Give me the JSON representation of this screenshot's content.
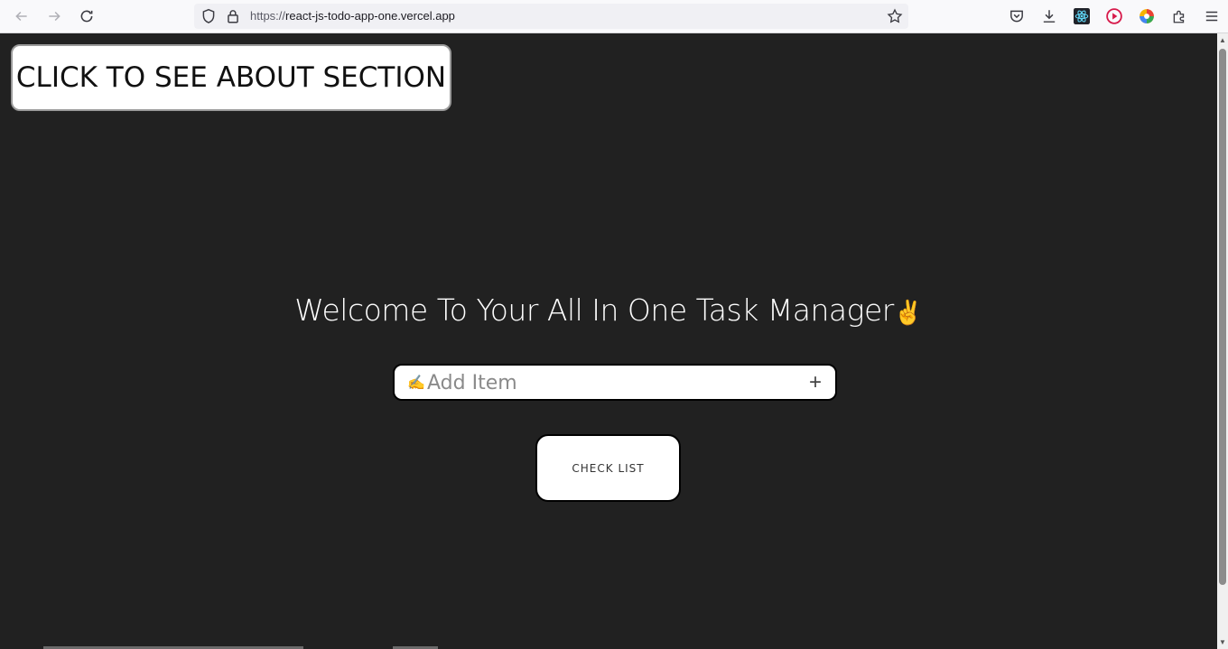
{
  "browser": {
    "url_scheme": "https://",
    "url_host": "react-js-todo-app-one.vercel.app",
    "icons": [
      "back-icon",
      "forward-icon",
      "reload-icon",
      "shield-icon",
      "lock-icon",
      "bookmark-star-icon",
      "pocket-icon",
      "download-icon",
      "react-devtools-icon",
      "media-extension-icon",
      "color-extension-icon",
      "extensions-icon",
      "menu-icon"
    ]
  },
  "page": {
    "about_button": "CLICK TO SEE ABOUT SECTION",
    "welcome_text": "Welcome To Your All In One Task Manager",
    "welcome_emoji": "✌️",
    "add_item": {
      "pencil": "✍",
      "placeholder": "Add Item",
      "value": "",
      "add_symbol": "+"
    },
    "check_list_button": "CHECK LIST"
  },
  "colors": {
    "background": "#212121",
    "button_bg": "#ffffff",
    "text_light": "#ffffff"
  }
}
